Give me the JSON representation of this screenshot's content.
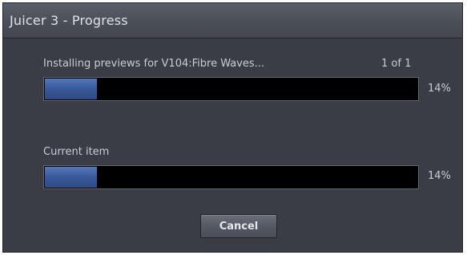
{
  "window": {
    "title": "Juicer 3 - Progress"
  },
  "overall": {
    "status_text": "Installing previews for V104:Fibre Waves...",
    "count_text": "1 of 1",
    "progress": 0.14,
    "percent_text": "14%"
  },
  "current": {
    "label": "Current item",
    "progress": 0.14,
    "percent_text": "14%"
  },
  "buttons": {
    "cancel_label": "Cancel"
  },
  "colors": {
    "background": "#3a3d45",
    "progress_fill": "#3a5b9c",
    "progress_track": "#000000"
  }
}
